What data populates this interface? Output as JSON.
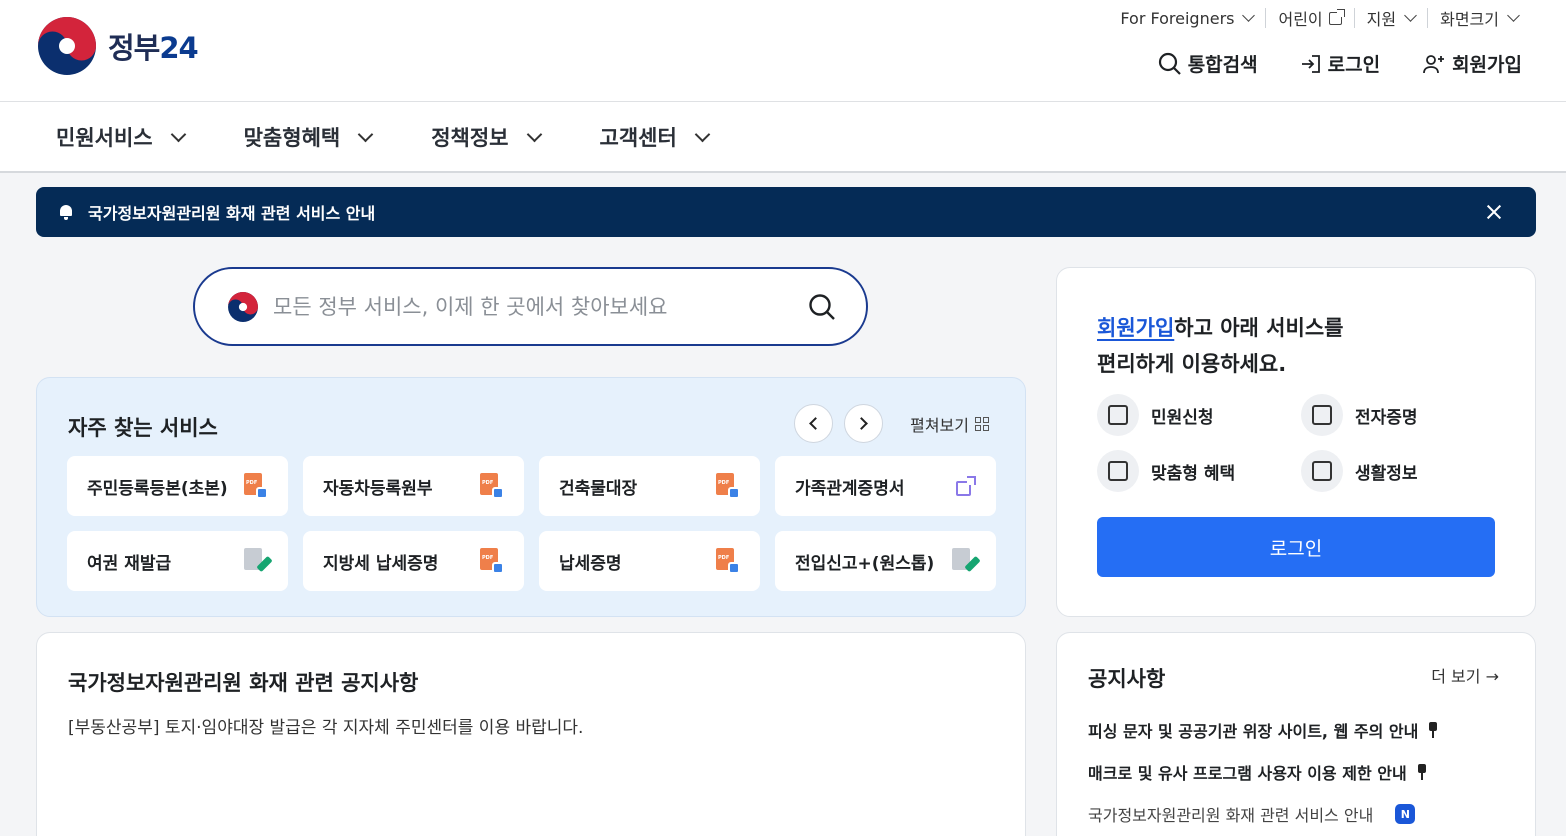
{
  "header": {
    "logo_text": "정부",
    "logo_num": "24",
    "utility": [
      {
        "label": "For Foreigners"
      },
      {
        "label": "어린이"
      },
      {
        "label": "지원"
      },
      {
        "label": "화면크기"
      }
    ],
    "user_menu": {
      "search": "통합검색",
      "login": "로그인",
      "signup": "회원가입"
    }
  },
  "gnb": {
    "items": [
      {
        "label": "민원서비스"
      },
      {
        "label": "맞춤형혜택"
      },
      {
        "label": "정책정보"
      },
      {
        "label": "고객센터"
      }
    ]
  },
  "notice_bar": {
    "text": "국가정보자원관리원 화재 관련 서비스 안내"
  },
  "search": {
    "placeholder": "모든 정부 서비스, 이제 한 곳에서 찾아보세요"
  },
  "frequent": {
    "title": "자주 찾는 서비스",
    "expand_label": "펼쳐보기",
    "items": [
      {
        "label": "주민등록등본(초본)",
        "icon": "pdf-print-icon"
      },
      {
        "label": "자동차등록원부",
        "icon": "pdf-print-icon"
      },
      {
        "label": "건축물대장",
        "icon": "pdf-print-icon"
      },
      {
        "label": "가족관계증명서",
        "icon": "external-link-icon"
      },
      {
        "label": "여권 재발급",
        "icon": "edit-document-icon"
      },
      {
        "label": "지방세 납세증명",
        "icon": "pdf-print-icon"
      },
      {
        "label": "납세증명",
        "icon": "pdf-print-icon"
      },
      {
        "label": "전입신고+(원스톱)",
        "icon": "edit-document-icon"
      }
    ]
  },
  "fire_notice": {
    "title": "국가정보자원관리원 화재 관련 공지사항",
    "desc": "[부동산공부] 토지·임야대장 발급은 각 지자체 주민센터를 이용 바랍니다."
  },
  "login_card": {
    "msg_link": "회원가입",
    "msg_rest": "하고 아래 서비스를",
    "msg_line2": "편리하게 이용하세요.",
    "quick": [
      {
        "label": "민원신청",
        "icon": "envelope-icon"
      },
      {
        "label": "전자증명",
        "icon": "id-card-icon"
      },
      {
        "label": "맞춤형 혜택",
        "icon": "gift-icon"
      },
      {
        "label": "생활정보",
        "icon": "bookmark-icon"
      }
    ],
    "button": "로그인"
  },
  "notices": {
    "title": "공지사항",
    "more": "더 보기 →",
    "items": [
      {
        "text": "피싱 문자 및 공공기관 위장 사이트, 웹 주의 안내",
        "pinned": true
      },
      {
        "text": "매크로 및 유사 프로그램 사용자 이용 제한 안내",
        "pinned": true
      },
      {
        "text": "국가정보자원관리원 화재 관련 서비스 안내",
        "badge": "N"
      }
    ]
  },
  "colors": {
    "brand_navy": "#052b56",
    "primary_blue": "#256ef4",
    "freq_bg": "#e6f1fc"
  }
}
